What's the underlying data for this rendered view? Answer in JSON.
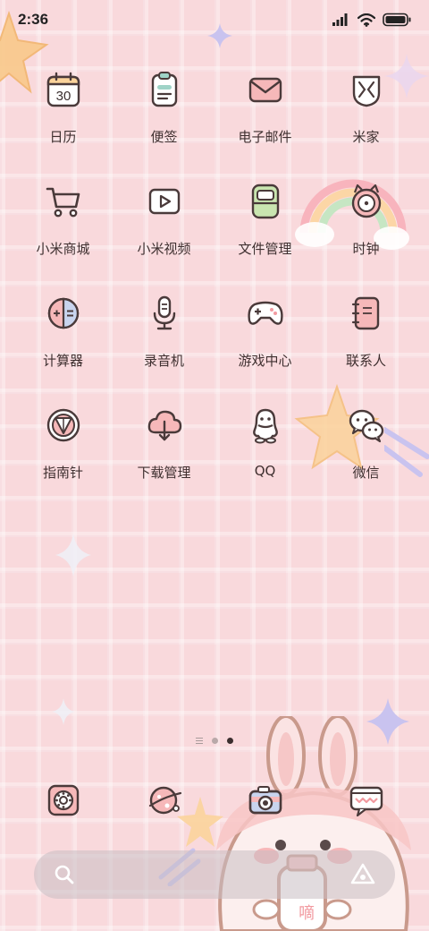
{
  "status_bar": {
    "time": "2:36",
    "icons": [
      "signal-icon",
      "wifi-icon",
      "battery-icon"
    ]
  },
  "apps": [
    {
      "label": "日历",
      "icon": "calendar-icon",
      "badge_text": "30"
    },
    {
      "label": "便签",
      "icon": "notes-icon"
    },
    {
      "label": "电子邮件",
      "icon": "email-icon"
    },
    {
      "label": "米家",
      "icon": "mijia-icon"
    },
    {
      "label": "小米商城",
      "icon": "shopping-cart-icon"
    },
    {
      "label": "小米视频",
      "icon": "video-play-icon"
    },
    {
      "label": "文件管理",
      "icon": "file-manager-icon"
    },
    {
      "label": "时钟",
      "icon": "clock-icon"
    },
    {
      "label": "计算器",
      "icon": "calculator-icon"
    },
    {
      "label": "录音机",
      "icon": "microphone-icon"
    },
    {
      "label": "游戏中心",
      "icon": "gamepad-icon"
    },
    {
      "label": "联系人",
      "icon": "contacts-icon"
    },
    {
      "label": "指南针",
      "icon": "compass-icon"
    },
    {
      "label": "下载管理",
      "icon": "download-cloud-icon"
    },
    {
      "label": "QQ",
      "icon": "qq-penguin-icon"
    },
    {
      "label": "微信",
      "icon": "wechat-icon"
    }
  ],
  "page_indicator": {
    "pages": 2,
    "active_page": 2
  },
  "dock": [
    {
      "icon": "phone-dial-icon"
    },
    {
      "icon": "messages-planet-icon"
    },
    {
      "icon": "camera-icon"
    },
    {
      "icon": "chat-bubble-icon"
    }
  ],
  "search_bar": {
    "icons": [
      "search-icon",
      "lens-icon"
    ]
  },
  "colors": {
    "background": "#f9d9dc",
    "icon_stroke": "#4a3a3a",
    "accent_pink": "#f2a7ad"
  },
  "wallpaper": {
    "mascot_text": "嘀"
  }
}
